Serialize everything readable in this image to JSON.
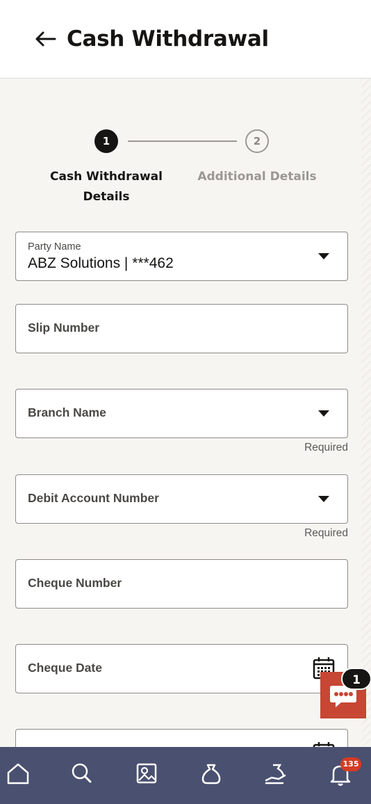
{
  "header": {
    "back_icon": "arrow-left-icon",
    "title": "Cash Withdrawal"
  },
  "stepper": {
    "steps": [
      {
        "number": "1",
        "label": "Cash Withdrawal Details",
        "state": "active"
      },
      {
        "number": "2",
        "label": "Additional Details",
        "state": "inactive"
      }
    ]
  },
  "form": {
    "party_name": {
      "label": "Party Name",
      "value": "ABZ Solutions | ***462"
    },
    "slip_number": {
      "placeholder": "Slip Number"
    },
    "branch_name": {
      "placeholder": "Branch Name",
      "hint": "Required"
    },
    "debit_account": {
      "placeholder": "Debit Account Number",
      "hint": "Required"
    },
    "cheque_number": {
      "placeholder": "Cheque Number"
    },
    "cheque_date": {
      "placeholder": "Cheque Date"
    }
  },
  "chat": {
    "icon": "chat-icon",
    "badge": "1",
    "color": "#c74634"
  },
  "bottom_nav": {
    "items": [
      "home-icon",
      "search-icon",
      "image-icon",
      "bag-icon",
      "investment-icon",
      "bell-icon"
    ],
    "notification_count": "135"
  },
  "colors": {
    "nav": "#4a5070",
    "accent": "#c74634",
    "badge": "#d63b25"
  }
}
